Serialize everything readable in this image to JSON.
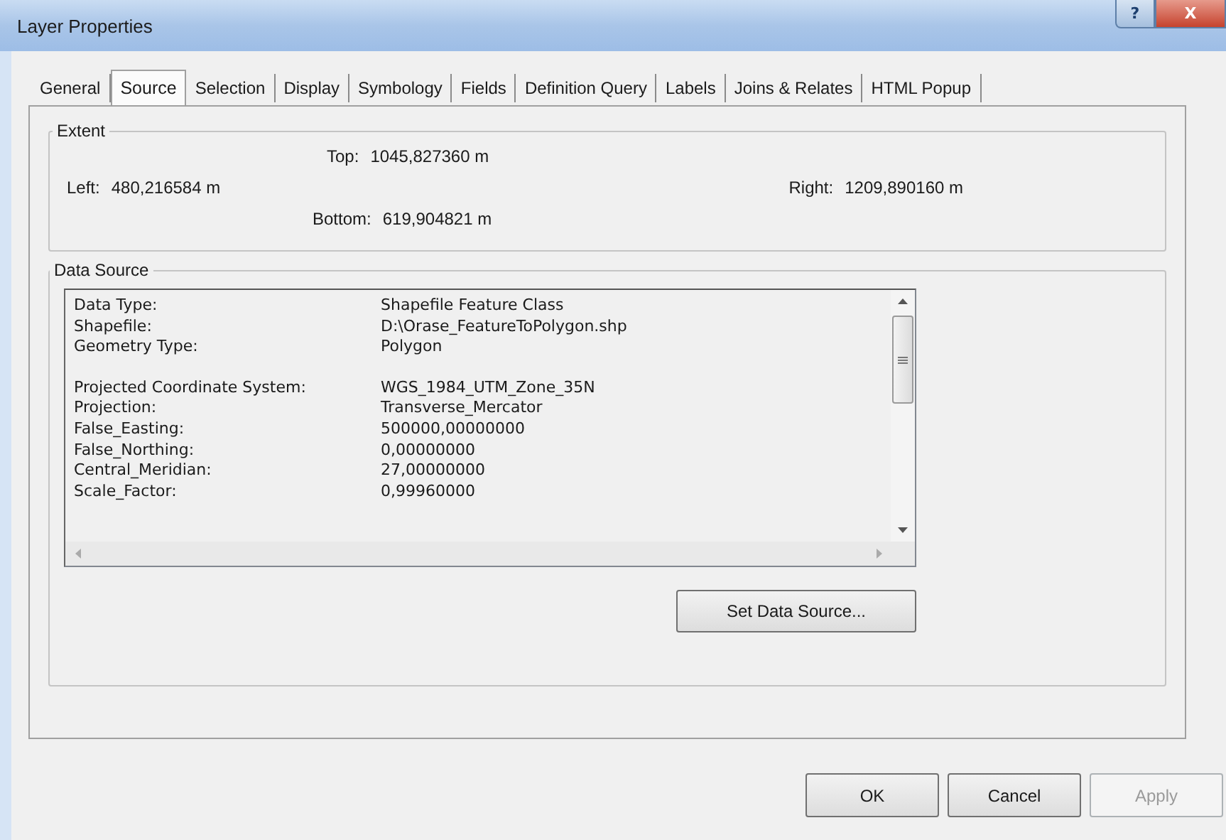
{
  "window": {
    "title": "Layer Properties",
    "help_button": "?",
    "close_button": "X"
  },
  "tabs": [
    {
      "label": "General",
      "selected": false
    },
    {
      "label": "Source",
      "selected": true
    },
    {
      "label": "Selection",
      "selected": false
    },
    {
      "label": "Display",
      "selected": false
    },
    {
      "label": "Symbology",
      "selected": false
    },
    {
      "label": "Fields",
      "selected": false
    },
    {
      "label": "Definition Query",
      "selected": false
    },
    {
      "label": "Labels",
      "selected": false
    },
    {
      "label": "Joins & Relates",
      "selected": false
    },
    {
      "label": "HTML Popup",
      "selected": false
    }
  ],
  "extent": {
    "title": "Extent",
    "top_label": "Top:",
    "top": "1045,827360 m",
    "left_label": "Left:",
    "left": "480,216584 m",
    "right_label": "Right:",
    "right": "1209,890160 m",
    "bottom_label": "Bottom:",
    "bottom": "619,904821 m"
  },
  "data_source": {
    "title": "Data Source",
    "groups": [
      [
        {
          "name": "Data Type:",
          "value": "Shapefile Feature Class"
        },
        {
          "name": "Shapefile:",
          "value": "D:\\Orase_FeatureToPolygon.shp"
        },
        {
          "name": "Geometry Type:",
          "value": "Polygon"
        }
      ],
      [
        {
          "name": "Projected Coordinate System:",
          "value": "WGS_1984_UTM_Zone_35N"
        },
        {
          "name": "Projection:",
          "value": "Transverse_Mercator"
        },
        {
          "name": "False_Easting:",
          "value": "500000,00000000"
        },
        {
          "name": "False_Northing:",
          "value": "0,00000000"
        },
        {
          "name": "Central_Meridian:",
          "value": "27,00000000"
        },
        {
          "name": "Scale_Factor:",
          "value": "0,99960000"
        }
      ]
    ],
    "button": "Set Data Source..."
  },
  "buttons": [
    {
      "label": "OK",
      "disabled": false
    },
    {
      "label": "Cancel",
      "disabled": false
    },
    {
      "label": "Apply",
      "disabled": true
    }
  ]
}
